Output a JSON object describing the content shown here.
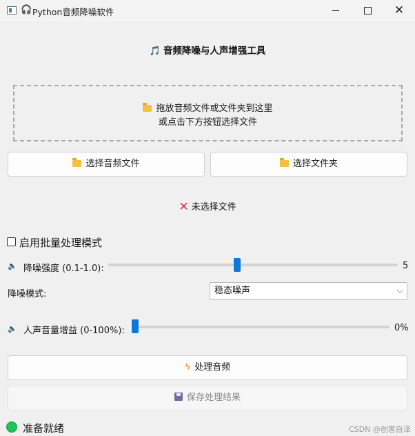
{
  "window": {
    "title": "Python音频降噪软件",
    "controls": {
      "minimize": "minimize-icon",
      "maximize": "maximize-icon",
      "close": "close-icon"
    }
  },
  "header": {
    "title": "音频降噪与人声增强工具"
  },
  "dropzone": {
    "line1": "拖放音频文件或文件夹到这里",
    "line2": "或点击下方按钮选择文件"
  },
  "buttons": {
    "select_file": "选择音频文件",
    "select_folder": "选择文件夹",
    "process": "处理音频",
    "save": "保存处理结果"
  },
  "file_status": "未选择文件",
  "batch": {
    "label": "启用批量处理模式",
    "checked": false
  },
  "noise_reduction": {
    "label": "降噪强度 (0.1-1.0):",
    "value": "5",
    "min": 1,
    "max": 10,
    "level": 5
  },
  "mode": {
    "label": "降噪模式:",
    "selected": "稳态噪声"
  },
  "vocal_gain": {
    "label": "人声音量增益 (0-100%):",
    "value": "0%",
    "level": 0
  },
  "status": {
    "text": "准备就绪",
    "color": "#20c35a"
  },
  "watermark": "CSDN @创客白泽",
  "colors": {
    "accent": "#0f78d7",
    "error": "#e0324e",
    "bolt": "#f28b25"
  }
}
